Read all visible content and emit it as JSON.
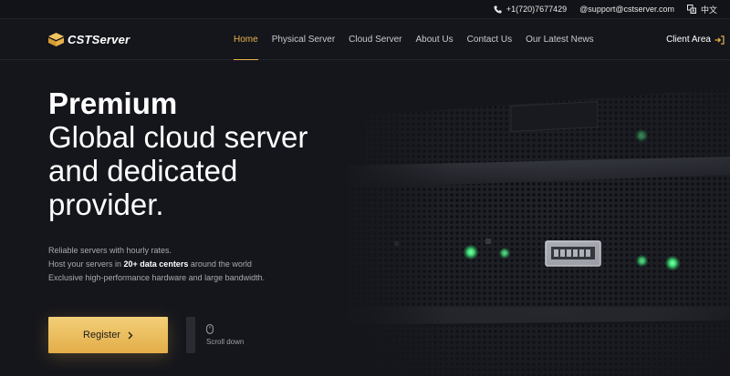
{
  "topbar": {
    "phone": "+1(720)7677429",
    "email": "@support@cstserver.com",
    "language": "中文"
  },
  "header": {
    "logo_text": "CSTServer",
    "nav": [
      {
        "label": "Home",
        "active": true
      },
      {
        "label": "Physical Server",
        "active": false
      },
      {
        "label": "Cloud Server",
        "active": false
      },
      {
        "label": "About Us",
        "active": false
      },
      {
        "label": "Contact Us",
        "active": false
      },
      {
        "label": "Our Latest News",
        "active": false
      }
    ],
    "client_area": "Client Area"
  },
  "hero": {
    "title_bold": "Premium",
    "title_line2": "Global cloud server",
    "title_line3": "and dedicated",
    "title_line4": "provider.",
    "desc_line1": "Reliable servers with hourly rates.",
    "desc_line2_pre": "Host your servers in ",
    "desc_line2_bold": "20+ data centers",
    "desc_line2_post": " around the world",
    "desc_line3": "Exclusive high-performance hardware and large bandwidth.",
    "register_label": "Register",
    "scroll_label": "Scroll down"
  },
  "colors": {
    "accent": "#e9b44c",
    "background": "#15161c",
    "led": "#3edb74"
  }
}
